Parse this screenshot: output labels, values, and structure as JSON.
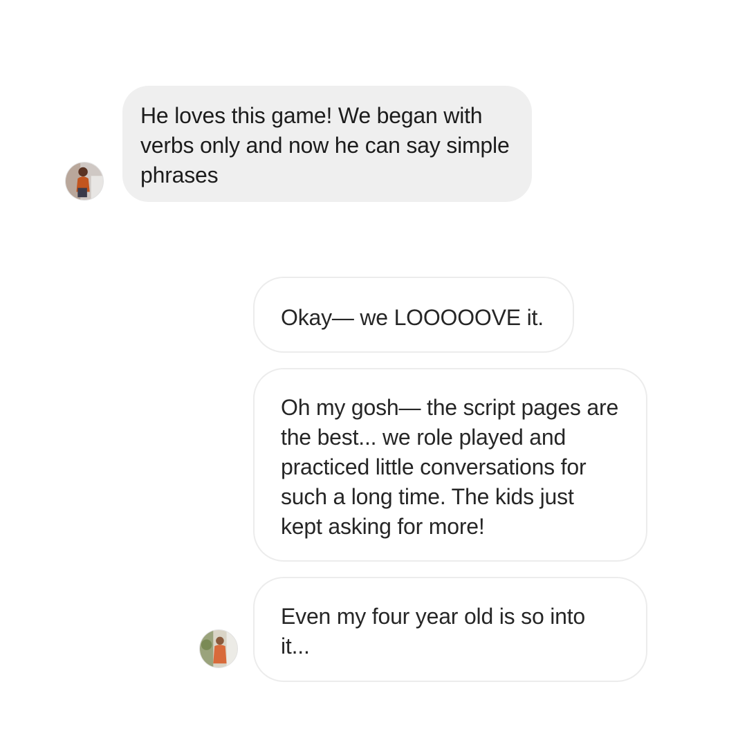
{
  "thread": {
    "messages": [
      {
        "sender": "other",
        "text": "He loves this game! We began with verbs only and now he can say simple phrases"
      },
      {
        "sender": "sender_b",
        "text": "Okay— we LOOOOOVE it."
      },
      {
        "sender": "sender_b",
        "text": "Oh my gosh— the script pages are the best... we role played and practiced little conversations for such a long time. The kids just kept asking for more!"
      },
      {
        "sender": "sender_b",
        "text": "Even my four year old is so into it..."
      }
    ]
  },
  "colors": {
    "gray_bubble": "#efefef",
    "outline_bubble_border": "#ececec",
    "text": "#262626",
    "background": "#ffffff"
  },
  "icons": {
    "avatar_1": "profile-photo-avatar",
    "avatar_2": "profile-photo-avatar"
  }
}
